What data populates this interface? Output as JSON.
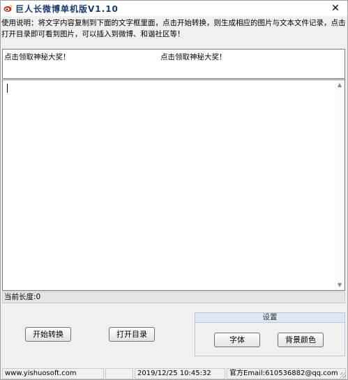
{
  "window": {
    "title": "巨人长微博单机版V1.10",
    "close_glyph": "✕"
  },
  "instructions": "使用说明：将文字内容复制到下面的文字框里面，点击开始转换，则生成相应的图片与文本文件记录，点击打开目录即可看到图片，可以插入到微博、和谐社区等！",
  "marquee": {
    "item_a": "点击领取神秘大奖！",
    "item_b": "点击领取神秘大奖！"
  },
  "editor": {
    "content": ""
  },
  "status": {
    "length_label": "当前长度:0"
  },
  "buttons": {
    "start": "开始转换",
    "open_dir": "打开目录"
  },
  "settings": {
    "title": "设置",
    "font": "字体",
    "bg_color": "背景颜色"
  },
  "footer": {
    "site": "www.yishuosoft.com",
    "blank": "",
    "datetime": "2019/12/25 10:45:32",
    "email": "官方Email:610536882@qq.com"
  },
  "colors": {
    "accent": "#1a3a6e",
    "icon_red": "#d42a1e",
    "icon_yellow": "#f5b800"
  }
}
